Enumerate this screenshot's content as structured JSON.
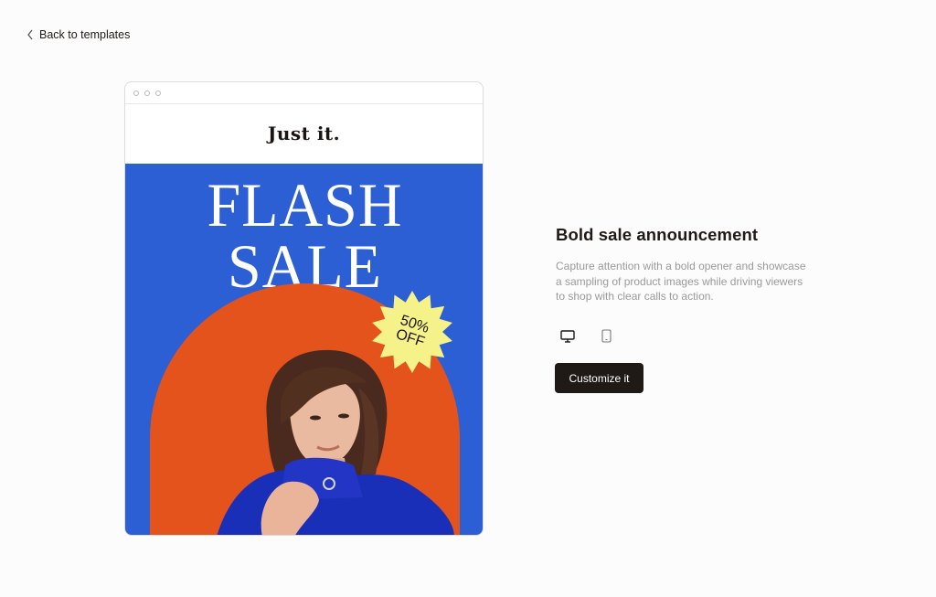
{
  "nav": {
    "back_label": "Back to templates",
    "back_icon": "chevron-left-icon"
  },
  "preview": {
    "window_controls": [
      "dot-icon",
      "dot-icon",
      "dot-icon"
    ],
    "brand_name": "Just it.",
    "headline": "FLASH SALE",
    "badge_line1": "50%",
    "badge_line2": "OFF",
    "colors": {
      "hero_background": "#2c5fd3",
      "arch": "#e5531d",
      "badge": "#f6f28a",
      "sweater": "#1a2fb8"
    }
  },
  "template": {
    "title": "Bold sale announcement",
    "description": "Capture attention with a bold opener and showcase a sampling of product images while driving viewers to shop with clear calls to action.",
    "device_options": [
      {
        "icon": "desktop-icon",
        "selected": true
      },
      {
        "icon": "mobile-icon",
        "selected": false
      }
    ],
    "cta_label": "Customize it"
  }
}
